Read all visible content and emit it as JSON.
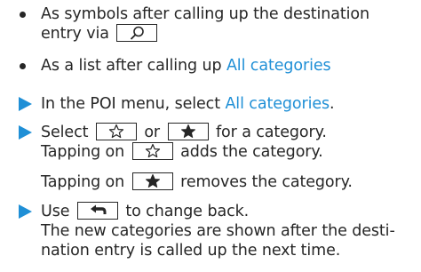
{
  "bullets": [
    {
      "line1": "As symbols after calling up the destination",
      "line2_prefix": "entry via",
      "icon": "magnifier-icon"
    },
    {
      "prefix": "As a list after calling up",
      "link": "All categories"
    }
  ],
  "steps": {
    "step1_prefix": "In the POI menu, select",
    "step1_link": "All categories",
    "step1_suffix": ".",
    "step2_select": "Select",
    "step2_or": "or",
    "step2_suffix": "for a category.",
    "step2_adds_prefix": "Tapping on",
    "step2_adds_suffix": "adds the category.",
    "step2_removes_prefix": "Tapping on",
    "step2_removes_suffix": "removes the category.",
    "step3_use": "Use",
    "step3_suffix": "to change back.",
    "step3_line2": "The new categories are shown after the desti-",
    "step3_line3": "nation entry is called up the next time."
  },
  "icons": {
    "empty_star": "star-outline-icon",
    "filled_star": "star-filled-icon",
    "back": "back-arrow-icon",
    "search": "magnifier-icon"
  },
  "colors": {
    "text": "#262626",
    "accent": "#1f8fd6"
  }
}
